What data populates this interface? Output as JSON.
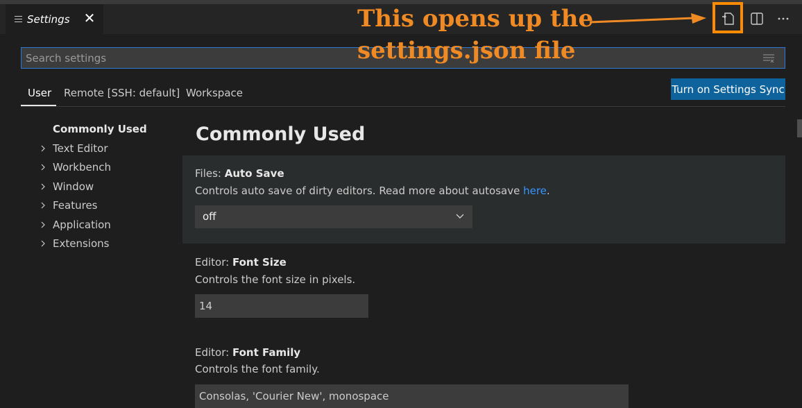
{
  "tab": {
    "title": "Settings",
    "close_glyph": "✕"
  },
  "toolbar": {
    "icons": [
      "open-settings-json-icon",
      "split-editor-icon",
      "more-actions-icon"
    ]
  },
  "annotation": {
    "line1": "This opens up the",
    "line2": "settings.json file",
    "color": "#f08a24"
  },
  "search": {
    "placeholder": "Search settings"
  },
  "scopes": [
    {
      "label": "User",
      "active": true
    },
    {
      "label": "Remote [SSH: default]",
      "active": false
    },
    {
      "label": "Workspace",
      "active": false
    }
  ],
  "sync_button": {
    "label": "Turn on Settings Sync",
    "color": "#0e639c"
  },
  "toc": [
    {
      "label": "Commonly Used",
      "expandable": false
    },
    {
      "label": "Text Editor",
      "expandable": true
    },
    {
      "label": "Workbench",
      "expandable": true
    },
    {
      "label": "Window",
      "expandable": true
    },
    {
      "label": "Features",
      "expandable": true
    },
    {
      "label": "Application",
      "expandable": true
    },
    {
      "label": "Extensions",
      "expandable": true
    }
  ],
  "section_title": "Commonly Used",
  "settings": [
    {
      "category": "Files: ",
      "name": "Auto Save",
      "description": "Controls auto save of dirty editors. Read more about autosave ",
      "link": "here",
      "link_suffix": ".",
      "value": "off"
    },
    {
      "category": "Editor: ",
      "name": "Font Size",
      "description": "Controls the font size in pixels.",
      "value": "14"
    },
    {
      "category": "Editor: ",
      "name": "Font Family",
      "description": "Controls the font family.",
      "value": "Consolas, 'Courier New', monospace"
    }
  ]
}
